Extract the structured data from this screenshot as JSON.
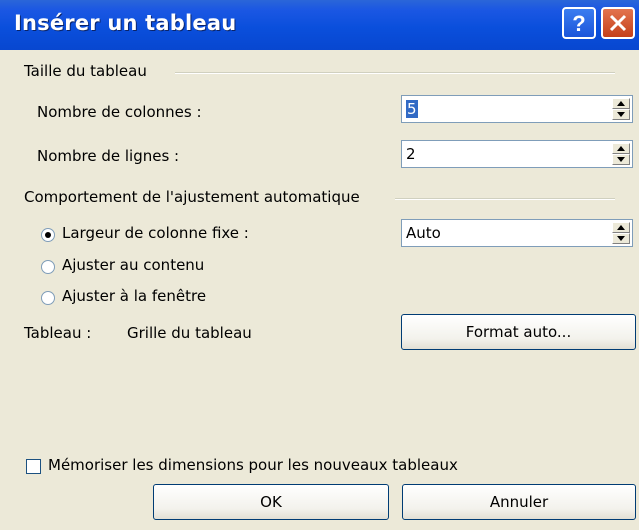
{
  "window": {
    "title": "Insérer un tableau",
    "help_label": "?",
    "close_label": "X"
  },
  "size_group": {
    "title": "Taille du tableau",
    "columns_label": "Nombre de colonnes :",
    "columns_value": "5",
    "rows_label": "Nombre de lignes :",
    "rows_value": "2"
  },
  "autofit_group": {
    "title": "Comportement de l'ajustement automatique",
    "options": [
      {
        "label": "Largeur de colonne fixe :",
        "selected": true
      },
      {
        "label": "Ajuster au contenu",
        "selected": false
      },
      {
        "label": "Ajuster à la fenêtre",
        "selected": false
      }
    ],
    "fixed_width_value": "Auto"
  },
  "table_style": {
    "label": "Tableau :",
    "value": "Grille du tableau",
    "format_button": "Format auto..."
  },
  "remember_checkbox": {
    "label": "Mémoriser les dimensions pour les nouveaux tableaux",
    "checked": false
  },
  "buttons": {
    "ok": "OK",
    "cancel": "Annuler"
  },
  "colors": {
    "titlebar": "#0A4FDC",
    "dialog_bg": "#ECE9D8",
    "selection": "#316AC5"
  }
}
